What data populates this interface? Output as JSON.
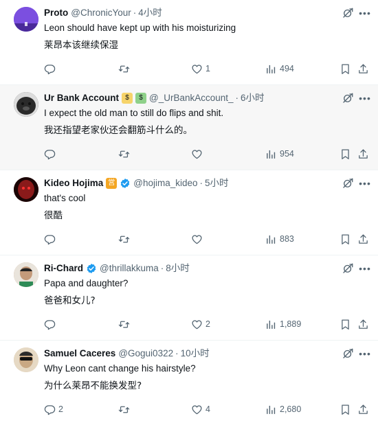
{
  "tweets": [
    {
      "name": "Proto",
      "handle": "@ChronicYour",
      "time": "4小时",
      "content": "Leon should have kept up with his moisturizing",
      "translation": "莱昂本该继续保湿",
      "replies": "",
      "likes": "1",
      "views": "494",
      "avatar_color": "#6a3fcf"
    },
    {
      "name": "Ur Bank Account",
      "handle": "@_UrBankAccount_",
      "time": "6小时",
      "content": "I expect the old man to still do flips and shit.",
      "translation": "我还指望老家伙还会翻筋斗什么的。",
      "replies": "",
      "likes": "",
      "views": "954",
      "avatar_color": "#3a3a3a"
    },
    {
      "name": "Kideo Hojima",
      "badge": "営",
      "handle": "@hojima_kideo",
      "time": "5小时",
      "content": "that's cool",
      "translation": "很酷",
      "replies": "",
      "likes": "",
      "views": "883",
      "avatar_color": "#5a0f0f"
    },
    {
      "name": "Ri-Chard",
      "handle": "@thrillakkuma",
      "time": "8小时",
      "content": "Papa and daughter?",
      "translation": "爸爸和女儿?",
      "replies": "",
      "likes": "2",
      "views": "1,889",
      "avatar_color": "#c49a7a"
    },
    {
      "name": "Samuel Caceres",
      "handle": "@Gogui0322",
      "time": "10小时",
      "content": "Why Leon cant change his hairstyle?",
      "translation": "为什么莱昂不能换发型?",
      "replies": "2",
      "likes": "4",
      "views": "2,680",
      "avatar_color": "#d8c8b0"
    }
  ],
  "colors": {
    "text": "#0f1419",
    "secondary": "#536471",
    "verified": "#1d9bf0",
    "badge": "#f4a623",
    "divider": "#eff3f4"
  }
}
